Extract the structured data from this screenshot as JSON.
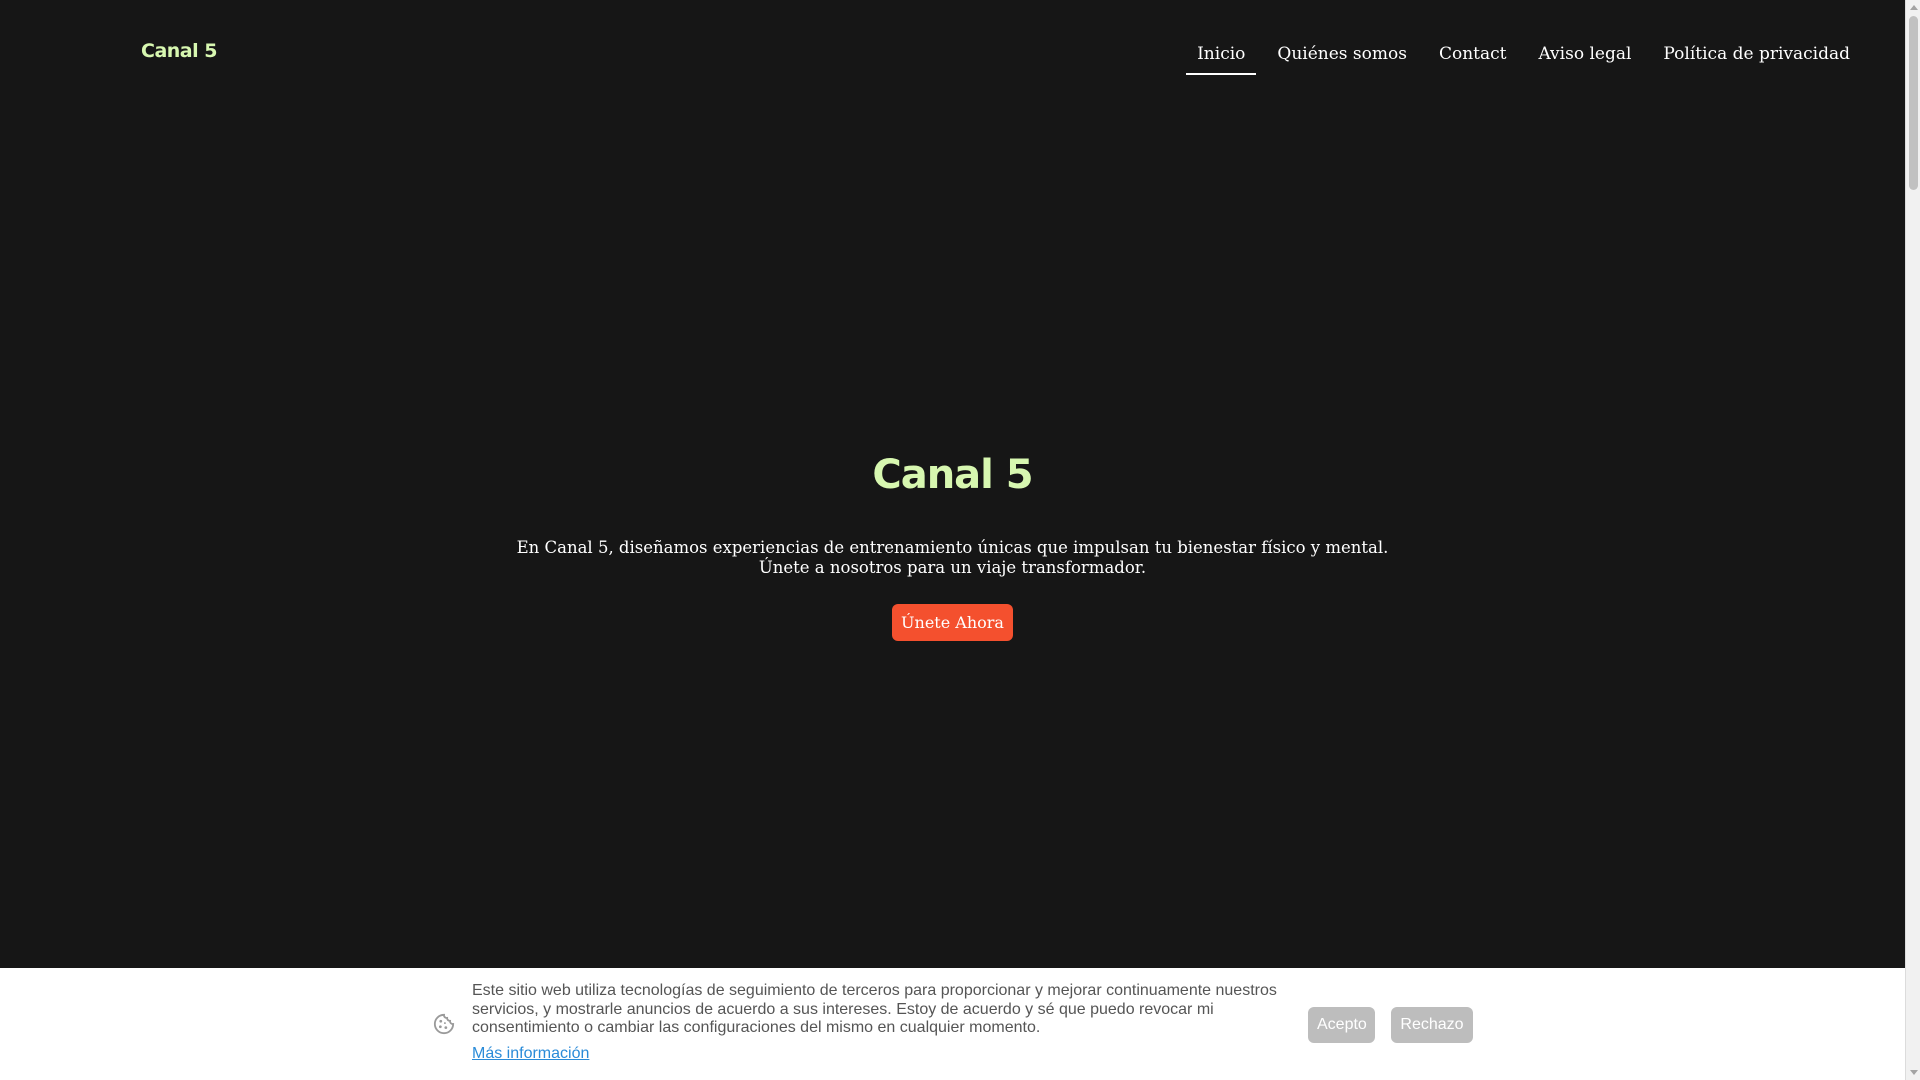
{
  "header": {
    "logo": "Canal 5",
    "nav": [
      {
        "label": "Inicio",
        "active": true
      },
      {
        "label": "Quiénes somos"
      },
      {
        "label": "Contact"
      },
      {
        "label": "Aviso legal"
      },
      {
        "label": "Política de privacidad"
      }
    ]
  },
  "hero": {
    "title": "Canal 5",
    "text": "En Canal 5, diseñamos experiencias de entrenamiento únicas que impulsan tu bienestar físico y mental. Únete a nosotros para un viaje transformador.",
    "cta": "Únete Ahora"
  },
  "cookie_banner": {
    "icon": "cookie-icon",
    "text": "Este sitio web utiliza tecnologías de seguimiento de terceros para proporcionar y mejorar continuamente nuestros servicios, y mostrarle anuncios de acuerdo a sus intereses. Estoy de acuerdo y sé que puedo revocar mi consentimiento o cambiar las configuraciones del mismo en cualquier momento.",
    "more_info": "Más información",
    "accept": "Acepto",
    "reject": "Rechazo"
  },
  "colors": {
    "background": "#161616",
    "accent_green": "#d7f7b0",
    "cta_orange": "#f4502e",
    "link_blue": "#2a8bd8",
    "button_gray": "#bdbdbd"
  }
}
